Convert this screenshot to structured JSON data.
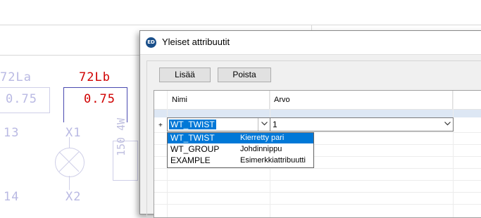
{
  "drawing": {
    "label_72la": "72La",
    "label_72lb": "72Lb",
    "value_left": "0.75",
    "value_right": "0.75",
    "label_13": "13",
    "label_x1": "X1",
    "label_14": "14",
    "label_x2": "X2",
    "resistor_text": "150 4W"
  },
  "dialog": {
    "icon_text": "ED",
    "title": "Yleiset attribuutit",
    "add_button": "Lisää",
    "remove_button": "Poista",
    "columns": [
      "Nimi",
      "Arvo"
    ],
    "row_marker": "+",
    "name_selected": "WT_TWIST",
    "value_field": "1",
    "dropdown_items": [
      {
        "name": "WT_TWIST",
        "desc": "Kierretty pari"
      },
      {
        "name": "WT_GROUP",
        "desc": "Johdinnippu"
      },
      {
        "name": "EXAMPLE",
        "desc": "Esimerkkiattribuutti"
      }
    ],
    "selected_index": 0,
    "accent_color": "#0078d7"
  }
}
